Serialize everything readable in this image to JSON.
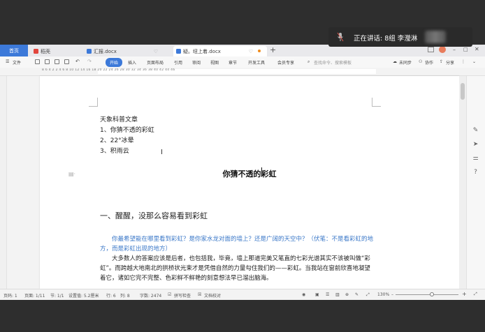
{
  "speaking": {
    "label": "正在讲话: 8组 李瀅淋"
  },
  "tabs": [
    {
      "label": "首页",
      "color": "#3c79d9"
    },
    {
      "label": "稻壳",
      "color": "#e2453c"
    },
    {
      "label": "汇报.docx",
      "color": "#3c79d9"
    },
    {
      "label": "疑。纽上着.docx",
      "color": "#3c79d9",
      "active": true
    }
  ],
  "tab_add": "+",
  "menu": {
    "file": "文件",
    "items": [
      "开始",
      "插入",
      "页面布局",
      "引用",
      "审阅",
      "视图",
      "章节",
      "开发工具",
      "会员专享"
    ],
    "search_placeholder": "查找命令、搜索模板",
    "unsynced": "未同步",
    "collab": "协作",
    "share": "分享"
  },
  "ruler_text": "8 6 4 2  2 4 6 8 10 12 14 16 18 20 22 24 26 28 30 32 34 36 38 40 42 44 46",
  "doc": {
    "lines": [
      "天象科普文章",
      "1、你猜不透的彩虹",
      "2、22°冰晕",
      "3、积雨云"
    ],
    "title": "你猜不透的彩虹",
    "heading": "一、醒醒，没那么容易看到彩虹",
    "para_blue": "你最希望能在哪里看到彩虹？是你家水龙对面的墙上？还是广阔的天空中？（伏笔：不是看彩虹的地方，而是彩虹出现的地方）",
    "para_body": "大多数人的答案应该是后者，也包括我，毕竟，墙上那道完美又笔直的七彩光谱其实不该被叫做“彩虹”。而跨越大地南北的拱桥状光束才是凭借自然的力量勾住我们的——彩虹。当我站在窗前欣喜地凝望着它，诸如它完不完整、色彩鲜不鲜艳的刻意想法早已溜出脑海。"
  },
  "status": {
    "page": "页码: 1",
    "pages": "页面: 1/11",
    "section": "节: 1/1",
    "setting": "设置值: 5.2厘米",
    "row": "行: 6",
    "col": "列: 8",
    "words": "字数: 2474",
    "spell": "拼写检查",
    "proof": "文档校对",
    "zoom": "130%",
    "zoom_level": 0.58
  },
  "colors": {
    "accent": "#3c79d9",
    "link_blue": "#3b78c8"
  }
}
